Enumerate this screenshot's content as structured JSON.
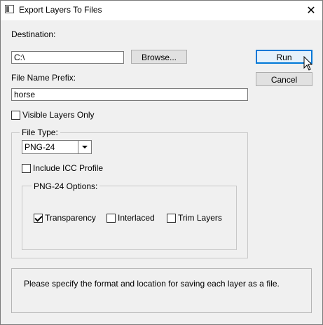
{
  "window": {
    "title": "Export Layers To Files",
    "close_glyph": "✕"
  },
  "destination": {
    "label": "Destination:",
    "value": "C:\\",
    "browse_label": "Browse..."
  },
  "prefix": {
    "label": "File Name Prefix:",
    "value": "horse"
  },
  "buttons": {
    "run_label": "Run",
    "cancel_label": "Cancel"
  },
  "visible_layers_only": {
    "label": "Visible Layers Only",
    "checked": false
  },
  "file_type": {
    "group_label": "File Type:",
    "selected": "PNG-24",
    "include_icc_label": "Include ICC Profile",
    "include_icc_checked": false
  },
  "png24_options": {
    "group_label": "PNG-24 Options:",
    "transparency_label": "Transparency",
    "transparency_checked": true,
    "interlaced_label": "Interlaced",
    "interlaced_checked": false,
    "trim_layers_label": "Trim Layers",
    "trim_layers_checked": false
  },
  "message": {
    "text": "Please specify the format and location for saving each layer as a file."
  },
  "icons": {
    "app": "window-app-icon",
    "close": "close-icon",
    "dropdown": "chevron-down-icon",
    "cursor": "mouse-cursor-icon"
  },
  "colors": {
    "window_bg": "#f0f0f0",
    "titlebar_bg": "#ffffff",
    "default_button_border": "#0078d7",
    "default_button_bg": "#e5f1fb"
  }
}
